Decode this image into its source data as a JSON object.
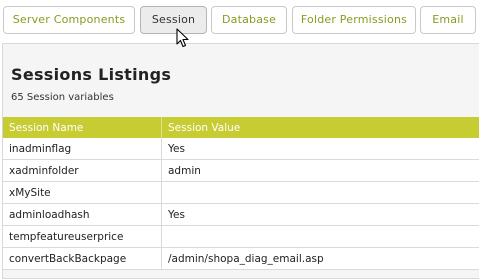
{
  "tabs": [
    {
      "label": "Server Components",
      "active": false
    },
    {
      "label": "Session",
      "active": true
    },
    {
      "label": "Database",
      "active": false
    },
    {
      "label": "Folder Permissions",
      "active": false
    },
    {
      "label": "Email",
      "active": false
    }
  ],
  "panel": {
    "title": "Sessions Listings",
    "subtitle": "65 Session variables"
  },
  "table": {
    "headers": [
      "Session Name",
      "Session Value"
    ],
    "rows": [
      [
        "inadminflag",
        "Yes"
      ],
      [
        "xadminfolder",
        "admin"
      ],
      [
        "xMySite",
        ""
      ],
      [
        "adminloadhash",
        "Yes"
      ],
      [
        "tempfeatureuserprice",
        ""
      ],
      [
        "convertBackBackpage",
        "/admin/shopa_diag_email.asp"
      ]
    ]
  },
  "colors": {
    "header_bg": "#c8cc33",
    "tab_text": "#8a9a1f",
    "panel_bg": "#f5f5f5"
  },
  "icons": {
    "cursor": "mouse-pointer-icon"
  }
}
